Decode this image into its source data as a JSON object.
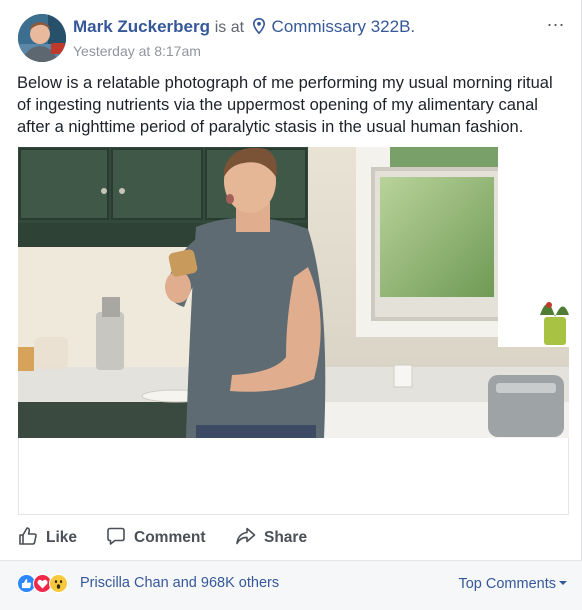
{
  "post": {
    "author": "Mark Zuckerberg",
    "is_at": "is at",
    "location": "Commissary 322B.",
    "timestamp": "Yesterday at 8:17am",
    "more_label": "...",
    "caption": "Below is a relatable photograph of me performing my usual morning ritual of ingesting nutrients via the uppermost opening of my alimentary canal after a nighttime period of paralytic stasis in the usual human fashion."
  },
  "actions": {
    "like": "Like",
    "comment": "Comment",
    "share": "Share"
  },
  "reactions": {
    "icons": [
      "like-icon",
      "love-icon",
      "wow-icon"
    ],
    "summary": "Priscilla Chan and 968K others",
    "top_comments": "Top Comments"
  },
  "colors": {
    "link": "#365899",
    "like_blue": "#2d88ff",
    "love_red": "#f0284a",
    "wow_yellow": "#f7c93e",
    "action_gray": "#4b4f56",
    "bar_bg": "#f6f7f9"
  }
}
